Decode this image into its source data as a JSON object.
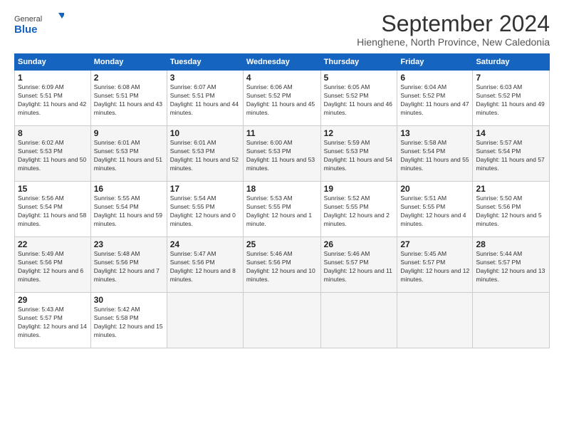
{
  "header": {
    "logo_general": "General",
    "logo_blue": "Blue",
    "month_title": "September 2024",
    "location": "Hienghene, North Province, New Caledonia"
  },
  "days_of_week": [
    "Sunday",
    "Monday",
    "Tuesday",
    "Wednesday",
    "Thursday",
    "Friday",
    "Saturday"
  ],
  "weeks": [
    [
      {
        "day": "1",
        "sunrise": "6:09 AM",
        "sunset": "5:51 PM",
        "daylight": "11 hours and 42 minutes."
      },
      {
        "day": "2",
        "sunrise": "6:08 AM",
        "sunset": "5:51 PM",
        "daylight": "11 hours and 43 minutes."
      },
      {
        "day": "3",
        "sunrise": "6:07 AM",
        "sunset": "5:51 PM",
        "daylight": "11 hours and 44 minutes."
      },
      {
        "day": "4",
        "sunrise": "6:06 AM",
        "sunset": "5:52 PM",
        "daylight": "11 hours and 45 minutes."
      },
      {
        "day": "5",
        "sunrise": "6:05 AM",
        "sunset": "5:52 PM",
        "daylight": "11 hours and 46 minutes."
      },
      {
        "day": "6",
        "sunrise": "6:04 AM",
        "sunset": "5:52 PM",
        "daylight": "11 hours and 47 minutes."
      },
      {
        "day": "7",
        "sunrise": "6:03 AM",
        "sunset": "5:52 PM",
        "daylight": "11 hours and 49 minutes."
      }
    ],
    [
      {
        "day": "8",
        "sunrise": "6:02 AM",
        "sunset": "5:53 PM",
        "daylight": "11 hours and 50 minutes."
      },
      {
        "day": "9",
        "sunrise": "6:01 AM",
        "sunset": "5:53 PM",
        "daylight": "11 hours and 51 minutes."
      },
      {
        "day": "10",
        "sunrise": "6:01 AM",
        "sunset": "5:53 PM",
        "daylight": "11 hours and 52 minutes."
      },
      {
        "day": "11",
        "sunrise": "6:00 AM",
        "sunset": "5:53 PM",
        "daylight": "11 hours and 53 minutes."
      },
      {
        "day": "12",
        "sunrise": "5:59 AM",
        "sunset": "5:53 PM",
        "daylight": "11 hours and 54 minutes."
      },
      {
        "day": "13",
        "sunrise": "5:58 AM",
        "sunset": "5:54 PM",
        "daylight": "11 hours and 55 minutes."
      },
      {
        "day": "14",
        "sunrise": "5:57 AM",
        "sunset": "5:54 PM",
        "daylight": "11 hours and 57 minutes."
      }
    ],
    [
      {
        "day": "15",
        "sunrise": "5:56 AM",
        "sunset": "5:54 PM",
        "daylight": "11 hours and 58 minutes."
      },
      {
        "day": "16",
        "sunrise": "5:55 AM",
        "sunset": "5:54 PM",
        "daylight": "11 hours and 59 minutes."
      },
      {
        "day": "17",
        "sunrise": "5:54 AM",
        "sunset": "5:55 PM",
        "daylight": "12 hours and 0 minutes."
      },
      {
        "day": "18",
        "sunrise": "5:53 AM",
        "sunset": "5:55 PM",
        "daylight": "12 hours and 1 minute."
      },
      {
        "day": "19",
        "sunrise": "5:52 AM",
        "sunset": "5:55 PM",
        "daylight": "12 hours and 2 minutes."
      },
      {
        "day": "20",
        "sunrise": "5:51 AM",
        "sunset": "5:55 PM",
        "daylight": "12 hours and 4 minutes."
      },
      {
        "day": "21",
        "sunrise": "5:50 AM",
        "sunset": "5:56 PM",
        "daylight": "12 hours and 5 minutes."
      }
    ],
    [
      {
        "day": "22",
        "sunrise": "5:49 AM",
        "sunset": "5:56 PM",
        "daylight": "12 hours and 6 minutes."
      },
      {
        "day": "23",
        "sunrise": "5:48 AM",
        "sunset": "5:56 PM",
        "daylight": "12 hours and 7 minutes."
      },
      {
        "day": "24",
        "sunrise": "5:47 AM",
        "sunset": "5:56 PM",
        "daylight": "12 hours and 8 minutes."
      },
      {
        "day": "25",
        "sunrise": "5:46 AM",
        "sunset": "5:56 PM",
        "daylight": "12 hours and 10 minutes."
      },
      {
        "day": "26",
        "sunrise": "5:46 AM",
        "sunset": "5:57 PM",
        "daylight": "12 hours and 11 minutes."
      },
      {
        "day": "27",
        "sunrise": "5:45 AM",
        "sunset": "5:57 PM",
        "daylight": "12 hours and 12 minutes."
      },
      {
        "day": "28",
        "sunrise": "5:44 AM",
        "sunset": "5:57 PM",
        "daylight": "12 hours and 13 minutes."
      }
    ],
    [
      {
        "day": "29",
        "sunrise": "5:43 AM",
        "sunset": "5:57 PM",
        "daylight": "12 hours and 14 minutes."
      },
      {
        "day": "30",
        "sunrise": "5:42 AM",
        "sunset": "5:58 PM",
        "daylight": "12 hours and 15 minutes."
      },
      null,
      null,
      null,
      null,
      null
    ]
  ],
  "labels": {
    "sunrise": "Sunrise:",
    "sunset": "Sunset:",
    "daylight": "Daylight:"
  }
}
